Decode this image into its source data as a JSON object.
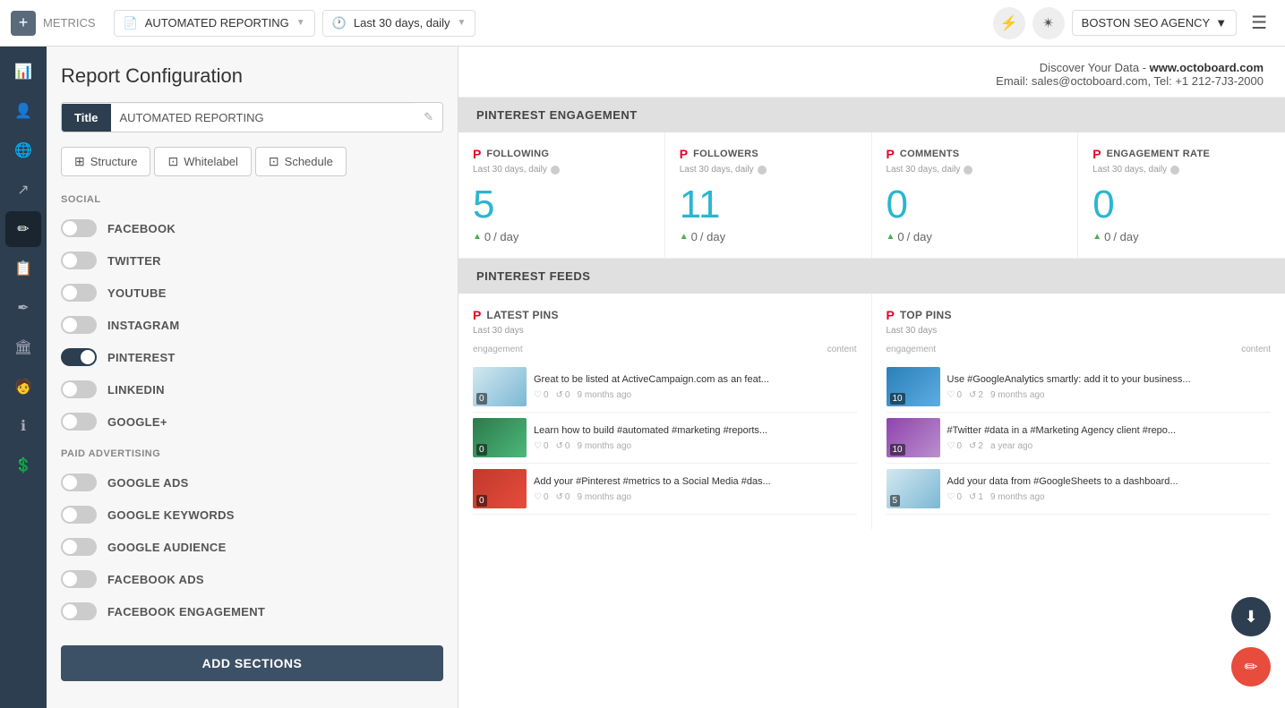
{
  "topnav": {
    "plus_label": "+",
    "metrics_label": "METRICS",
    "report_selector": "AUTOMATED REPORTING",
    "time_selector": "Last 30 days, daily",
    "agency_selector": "BOSTON SEO AGENCY",
    "flash_icon": "⚡",
    "bug_icon": "✴",
    "menu_icon": "☰"
  },
  "sidebar": {
    "icons": [
      {
        "name": "chart-icon",
        "symbol": "📊",
        "active": false
      },
      {
        "name": "users-icon",
        "symbol": "👤",
        "active": false
      },
      {
        "name": "globe-icon",
        "symbol": "🌐",
        "active": false
      },
      {
        "name": "flow-icon",
        "symbol": "↗",
        "active": false
      },
      {
        "name": "pen-icon",
        "symbol": "✏",
        "active": true
      },
      {
        "name": "clipboard-icon",
        "symbol": "📋",
        "active": false
      },
      {
        "name": "edit-icon",
        "symbol": "✒",
        "active": false
      },
      {
        "name": "building-icon",
        "symbol": "🏛",
        "active": false
      },
      {
        "name": "person-icon",
        "symbol": "🧑",
        "active": false
      },
      {
        "name": "info-icon",
        "symbol": "ℹ",
        "active": false
      },
      {
        "name": "bill-icon",
        "symbol": "💲",
        "active": false
      }
    ]
  },
  "config": {
    "title": "Report Configuration",
    "title_label": "Title",
    "title_value": "AUTOMATED REPORTING",
    "edit_icon": "✎",
    "tabs": [
      {
        "name": "structure-tab",
        "label": "Structure",
        "icon": "⊞"
      },
      {
        "name": "whitelabel-tab",
        "label": "Whitelabel",
        "icon": "⊡"
      },
      {
        "name": "schedule-tab",
        "label": "Schedule",
        "icon": "⊡"
      }
    ],
    "social_section": "SOCIAL",
    "social_items": [
      {
        "name": "facebook-toggle",
        "label": "FACEBOOK",
        "on": false
      },
      {
        "name": "twitter-toggle",
        "label": "TWITTER",
        "on": false
      },
      {
        "name": "youtube-toggle",
        "label": "YOUTUBE",
        "on": false
      },
      {
        "name": "instagram-toggle",
        "label": "INSTAGRAM",
        "on": false
      },
      {
        "name": "pinterest-toggle",
        "label": "PINTEREST",
        "on": true
      },
      {
        "name": "linkedin-toggle",
        "label": "LINKEDIN",
        "on": false
      },
      {
        "name": "googleplus-toggle",
        "label": "GOOGLE+",
        "on": false
      }
    ],
    "paid_section": "PAID ADVERTISING",
    "paid_items": [
      {
        "name": "google-ads-toggle",
        "label": "GOOGLE ADS",
        "on": false
      },
      {
        "name": "google-keywords-toggle",
        "label": "GOOGLE KEYWORDS",
        "on": false
      },
      {
        "name": "google-audience-toggle",
        "label": "GOOGLE AUDIENCE",
        "on": false
      },
      {
        "name": "facebook-ads-toggle",
        "label": "FACEBOOK ADS",
        "on": false
      },
      {
        "name": "facebook-engagement-toggle",
        "label": "FACEBOOK ENGAGEMENT",
        "on": false
      }
    ],
    "add_sections_btn": "ADD SECTIONS"
  },
  "report": {
    "header_text": "Discover Your Data - ",
    "header_url": "www.octoboard.com",
    "header_email_label": "Email:",
    "header_email": "sales@octoboard.com",
    "header_tel_label": "Tel:",
    "header_tel": "+1 212-7J3-2000",
    "engagement_section": "PINTEREST ENGAGEMENT",
    "metrics": [
      {
        "name": "following-metric",
        "label": "FOLLOWING",
        "sublabel": "Last 30 days, daily",
        "value": "5",
        "delta": "0",
        "delta_label": "/ day"
      },
      {
        "name": "followers-metric",
        "label": "FOLLOWERS",
        "sublabel": "Last 30 days, daily",
        "value": "11",
        "delta": "0",
        "delta_label": "/ day"
      },
      {
        "name": "comments-metric",
        "label": "COMMENTS",
        "sublabel": "Last 30 days, daily",
        "value": "0",
        "delta": "0",
        "delta_label": "/ day"
      },
      {
        "name": "engagement-rate-metric",
        "label": "ENGAGEMENT RATE",
        "sublabel": "Last 30 days, daily",
        "value": "0",
        "delta": "0",
        "delta_label": "/ day"
      }
    ],
    "feeds_section": "PINTEREST FEEDS",
    "feeds": [
      {
        "name": "latest-pins-feed",
        "title": "LATEST PINS",
        "sublabel": "Last 30 days",
        "col_left": "engagement",
        "col_right": "content",
        "items": [
          {
            "thumb_class": "feed-thumb-bg1",
            "badge": "0",
            "text": "Great to be listed at ActiveCampaign.com as an feat...",
            "likes": "0",
            "repins": "0",
            "time": "9 months ago"
          },
          {
            "thumb_class": "feed-thumb-bg2",
            "badge": "0",
            "text": "Learn how to build #automated #marketing #reports...",
            "likes": "0",
            "repins": "0",
            "time": "9 months ago"
          },
          {
            "thumb_class": "feed-thumb-bg3",
            "badge": "0",
            "text": "Add your #Pinterest #metrics to a Social Media #das...",
            "likes": "0",
            "repins": "0",
            "time": "9 months ago"
          }
        ]
      },
      {
        "name": "top-pins-feed",
        "title": "TOP PINS",
        "sublabel": "Last 30 days",
        "col_left": "engagement",
        "col_right": "content",
        "items": [
          {
            "thumb_class": "feed-thumb-bg4",
            "badge": "10",
            "text": "Use #GoogleAnalytics smartly: add it to your business...",
            "likes": "0",
            "repins": "2",
            "time": "9 months ago"
          },
          {
            "thumb_class": "feed-thumb-bg5",
            "badge": "10",
            "text": "#Twitter #data in a #Marketing Agency client #repo...",
            "likes": "0",
            "repins": "2",
            "time": "a year ago"
          },
          {
            "thumb_class": "feed-thumb-bg1",
            "badge": "5",
            "text": "Add your data from #GoogleSheets to a dashboard...",
            "likes": "0",
            "repins": "1",
            "time": "9 months ago"
          }
        ]
      }
    ]
  },
  "fabs": {
    "download_icon": "⬇",
    "edit_icon": "✏"
  }
}
